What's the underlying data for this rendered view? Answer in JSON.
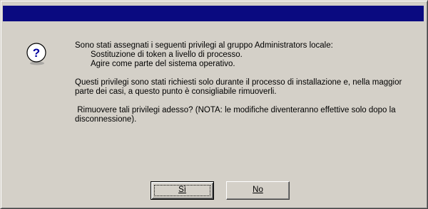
{
  "dialog": {
    "title": "",
    "icon": "question-icon",
    "message": {
      "line1": "Sono stati assegnati i seguenti privilegi al gruppo Administrators locale:",
      "privileges": [
        "Sostituzione di token a livello di processo.",
        "Agire come parte del sistema operativo."
      ],
      "paragraph2": "Questi privilegi sono stati richiesti solo durante il processo di installazione e, nella maggior parte dei casi, a questo punto è consigliabile rimuoverli.",
      "paragraph3": " Rimuovere tali privilegi adesso? (NOTA: le modifiche diventeranno effettive solo dopo la disconnessione)."
    },
    "buttons": {
      "yes_label": "Sì",
      "no_label": "No"
    }
  },
  "colors": {
    "titlebar": "#0a0a80",
    "face": "#d4d0c8"
  }
}
